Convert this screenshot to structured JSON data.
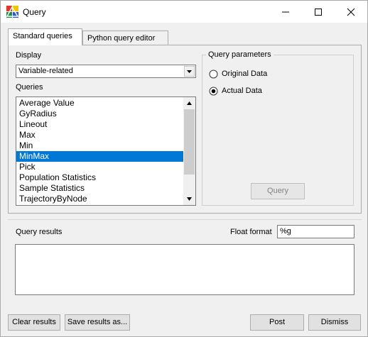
{
  "window": {
    "title": "Query"
  },
  "tabs": [
    {
      "label": "Standard queries"
    },
    {
      "label": "Python query editor"
    }
  ],
  "display": {
    "label": "Display",
    "selected": "Variable-related"
  },
  "queries": {
    "label": "Queries",
    "items": [
      "Average Value",
      "GyRadius",
      "Lineout",
      "Max",
      "Min",
      "MinMax",
      "Pick",
      "Population Statistics",
      "Sample Statistics",
      "TrajectoryByNode"
    ],
    "selected": "MinMax"
  },
  "query_parameters": {
    "title": "Query parameters",
    "options": [
      "Original Data",
      "Actual Data"
    ],
    "checked": "Actual Data",
    "query_button": "Query"
  },
  "results": {
    "label": "Query results",
    "float_format_label": "Float format",
    "float_format_value": "%g",
    "text": ""
  },
  "buttons": {
    "clear": "Clear results",
    "save": "Save results as...",
    "post": "Post",
    "dismiss": "Dismiss"
  },
  "colors": {
    "selection": "#0078d7",
    "window_bg": "#f0f0f0"
  },
  "icons": {
    "app": "visit-app-icon",
    "minimize": "minimize-icon",
    "maximize": "maximize-icon",
    "close": "close-icon"
  }
}
